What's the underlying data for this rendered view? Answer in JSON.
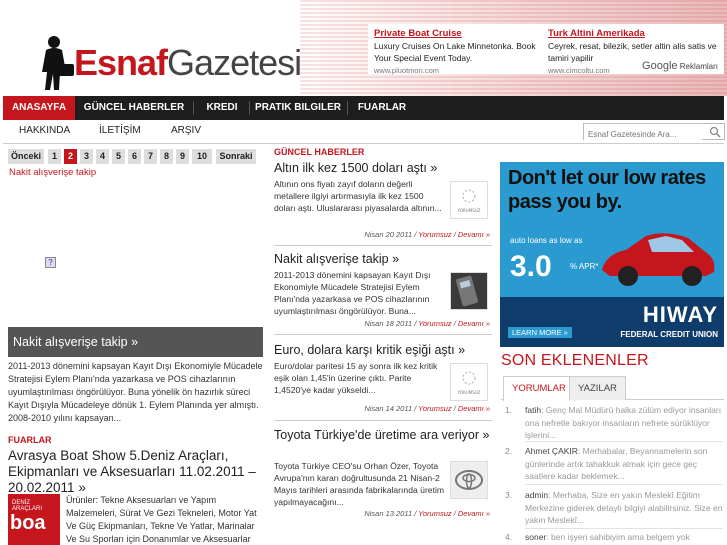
{
  "header": {
    "logo_part1": "Esnaf",
    "logo_part2": "Gazetesi",
    "ads": [
      {
        "title": "Private Boat Cruise",
        "text": "Luxury Cruises On Lake Minnetonka. Book Your Special Event Today.",
        "url": "www.pluotmon.com"
      },
      {
        "title": "Turk Altini Amerikada",
        "text": "Ceyrek, resat, bilezik, setler altin alis satis ve tamiri yapilir",
        "url": "www.cimcoltu.com"
      }
    ],
    "google_label": "Google",
    "ads_label": "Reklamları"
  },
  "nav": {
    "items": [
      "ANASAYFA",
      "GÜNCEL HABERLER",
      "KREDI",
      "PRATIK BILGILER",
      "FUARLAR"
    ],
    "active": "ANASAYFA"
  },
  "subnav": {
    "items": [
      "HAKKINDA",
      "İLETİŞİM",
      "ARŞIV"
    ],
    "search_placeholder": "Esnaf Gazetesinde Ara..."
  },
  "pager": {
    "prev": "Önceki",
    "pages": [
      "1",
      "2",
      "3",
      "4",
      "5",
      "6",
      "7",
      "8",
      "9",
      "10"
    ],
    "current": "2",
    "next": "Sonraki"
  },
  "left": {
    "link": "Nakit alışverişe takip",
    "feature_title": "Nakit alışverişe takip »",
    "feature_text": "2011-2013 dönemini kapsayan Kayıt Dışı Ekonomiyle Mücadele Stratejisi Eylem Planı'nda yazarkasa ve POS cihazlarının uyumlaştırılması öngörülüyor. Buna yönelik ön hazırlık süreci Kayıt Dışıyla Mücadeleye dönük 1. Eylem Planında yer almıştı. 2008-2010 yılını kapsayan...",
    "category": "FUARLAR",
    "post_title": "Avrasya Boat Show 5.Deniz Araçları, Ekipmanları ve Aksesuarları 11.02.2011 – 20.02.2011 »",
    "post_image_label": "boa",
    "post_image_small": "DENİZ ARAÇLARI",
    "post_text": "Ürünler: Tekne Aksesuarları ve Yapım Malzemeleri, Sürat Ve Gezi Tekneleri, Motor Yat Ve Güç Ekipmanları, Tekne Ve Yatlar, Marinalar Ve Su Sporları için Donanımlar ve Aksesuarlar"
  },
  "middle": {
    "category": "GÜNCEL HABERLER",
    "comments_label": "Yorumsuz",
    "more_label": "Devamı »",
    "articles": [
      {
        "title": "Altın ilk kez 1500 doları aştı »",
        "body": "Altının ons fiyatı zayıf doların değerli metallere ilgiyi artırmasıyla ilk kez 1500 doları aştı. Uluslararası piyasalarda altının...",
        "date": "Nisan 20 2011",
        "thumb": "YORUMSUZ"
      },
      {
        "title": "Nakit alışverişe takip »",
        "body": "2011-2013 dönemini kapsayan Kayıt Dışı Ekonomiyle Mücadele Stratejisi Eylem Planı'nda yazarkasa ve POS cihazlarının uyumlaştırılması öngörülüyor. Buna...",
        "date": "Nisan 18 2011",
        "thumb": ""
      },
      {
        "title": "Euro, dolara karşı kritik eşiği aştı »",
        "body": "Euro/dolar paritesi 15 ay sonra ilk kez kritik eşik olan 1,45'in üzerine çıktı. Parite 1,4520'ye kadar yükseldi...",
        "date": "Nisan 14 2011",
        "thumb": "YORUMSUZ"
      },
      {
        "title": "Toyota Türkiye'de üretime ara veriyor »",
        "body": "Toyota Türkiye CEO'su Orhan Özer, Toyota Avrupa'nın kararı doğrultusunda 21 Nisan-2 Mayıs tarihleri arasında fabrikalarında üretim yapılmayacağını...",
        "date": "Nisan 13 2011",
        "thumb": ""
      }
    ]
  },
  "right": {
    "banner": {
      "headline": "Don't let our low rates pass you by.",
      "sub": "auto loans as low as",
      "rate": "3.0",
      "apr": "% APR*",
      "brand": "HIWAY",
      "brand2": "FEDERAL CREDIT UNION",
      "more": "LEARN MORE »"
    },
    "recent_title": "SON EKLENENLER",
    "tabs": [
      "YORUMLAR",
      "YAZILAR"
    ],
    "comments": [
      {
        "num": "1.",
        "author": "fatih",
        "text": ": Genç Mal Müdürü halka zülüm ediyor insanları ona nefretle bakıyor insanların nefrete sürüklüyor işlerini..."
      },
      {
        "num": "2.",
        "author": "Ahmet ÇAKIR",
        "text": ": Merhabalar, Beyannamelerin son günlerinde artık tahakkuk almak için gece geç saatlere kadar beklemek..."
      },
      {
        "num": "3.",
        "author": "admin",
        "text": ": Merhaba, Size en yakın Meslekî Eğitim Merkezine giderek detaylı bilgiyi alabilirsiniz. Size en yakın Meslekî..."
      },
      {
        "num": "4.",
        "author": "soner",
        "text": ": ben işyeri sahibiyim ama belgem yok"
      }
    ]
  }
}
